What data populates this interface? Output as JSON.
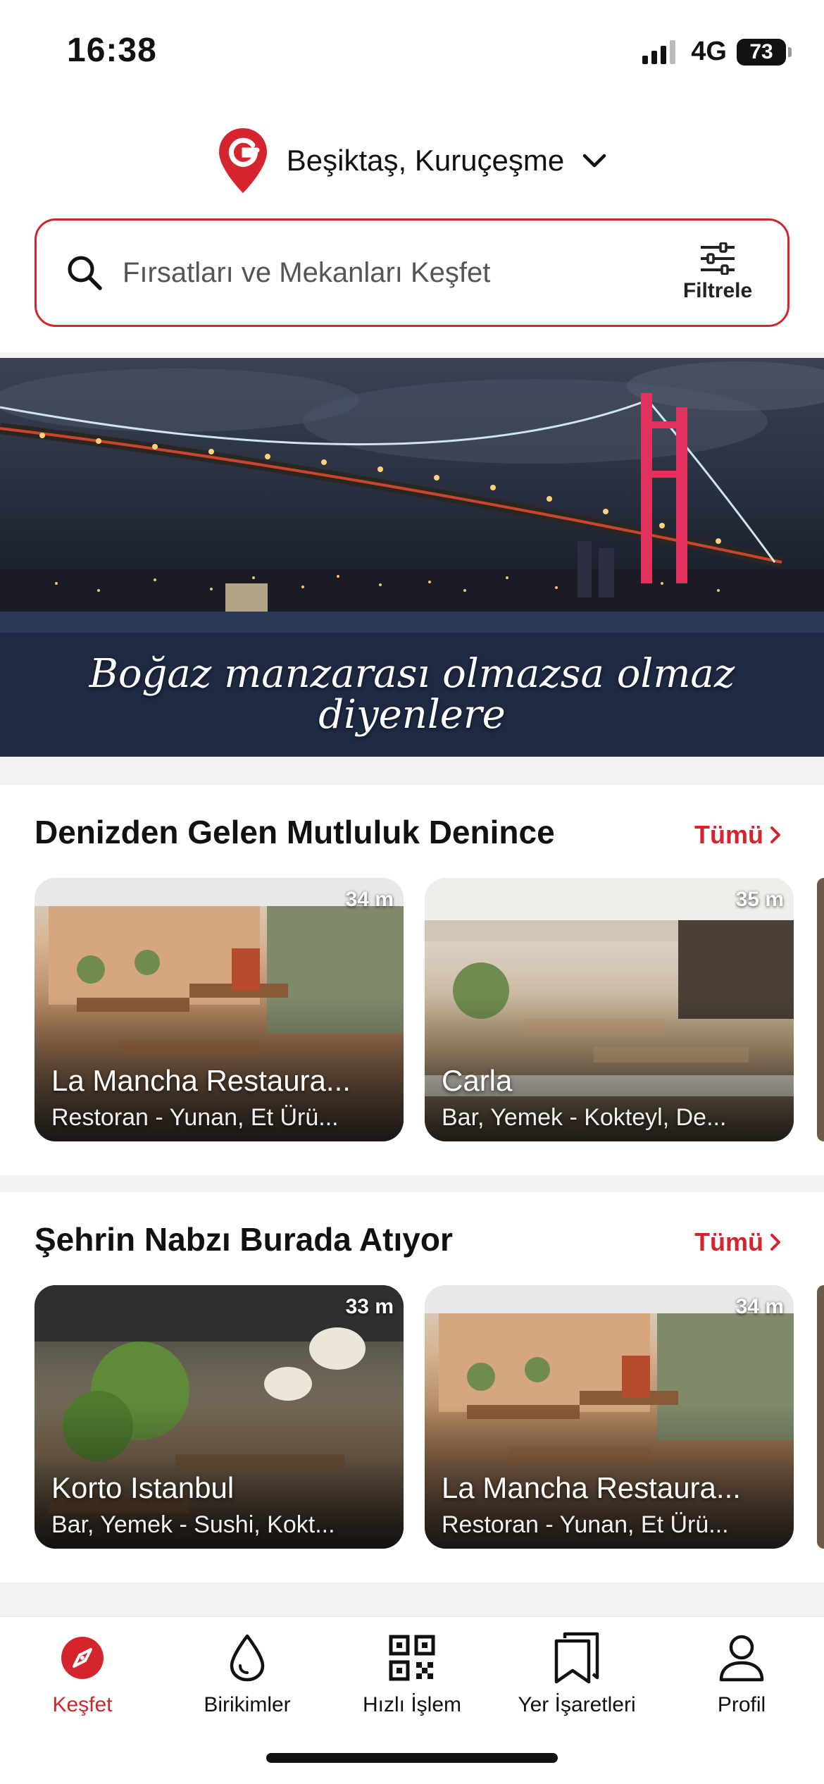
{
  "status_bar": {
    "time": "16:38",
    "network": "4G",
    "battery": "73"
  },
  "header": {
    "location": "Beşiktaş, Kuruçeşme",
    "search_placeholder": "Fırsatları ve Mekanları Keşfet",
    "filter_label": "Filtrele"
  },
  "hero": {
    "caption_line1": "Boğaz manzarası olmazsa olmaz",
    "caption_line2": "diyenlere"
  },
  "sections": [
    {
      "title": "Denizden Gelen Mutluluk Denince",
      "see_all": "Tümü",
      "cards": [
        {
          "name": "La Mancha Restaura...",
          "description": "Restoran - Yunan, Et Ürü...",
          "distance": "34 m"
        },
        {
          "name": "Carla",
          "description": "Bar, Yemek - Kokteyl, De...",
          "distance": "35 m"
        }
      ]
    },
    {
      "title": "Şehrin Nabzı Burada Atıyor",
      "see_all": "Tümü",
      "cards": [
        {
          "name": "Korto Istanbul",
          "description": "Bar, Yemek - Sushi, Kokt...",
          "distance": "33 m"
        },
        {
          "name": "La Mancha Restaura...",
          "description": "Restoran - Yunan, Et Ürü...",
          "distance": "34 m"
        }
      ]
    }
  ],
  "nav": [
    {
      "label": "Keşfet",
      "icon": "compass-icon",
      "active": true
    },
    {
      "label": "Birikimler",
      "icon": "drop-icon",
      "active": false
    },
    {
      "label": "Hızlı İşlem",
      "icon": "qr-code-icon",
      "active": false
    },
    {
      "label": "Yer İşaretleri",
      "icon": "bookmarks-icon",
      "active": false
    },
    {
      "label": "Profil",
      "icon": "profile-icon",
      "active": false
    }
  ],
  "colors": {
    "accent": "#d4252e"
  }
}
